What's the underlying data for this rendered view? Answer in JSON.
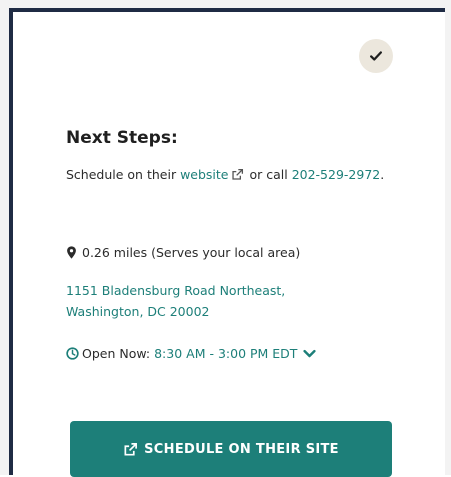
{
  "status": {
    "icon": "check-icon"
  },
  "next_steps": {
    "heading": "Next Steps:",
    "schedule_prefix": "Schedule on their ",
    "website_link": "website",
    "website_icon": "external-link-icon",
    "or_call": " or call ",
    "phone": "202-529-2972",
    "period": "."
  },
  "location": {
    "icon": "map-pin-icon",
    "distance": "0.26 miles (Serves your local area)",
    "address": "1151 Bladensburg Road Northeast, Washington, DC 20002"
  },
  "hours": {
    "icon": "clock-icon",
    "label": "Open Now:",
    "range": "8:30 AM - 3:00 PM EDT",
    "toggle_icon": "chevron-down-icon"
  },
  "cta": {
    "icon": "external-link-icon",
    "label": "SCHEDULE ON THEIR SITE"
  },
  "colors": {
    "accent": "#1d7f79",
    "border": "#1f2b44",
    "badge": "#ece7dd"
  }
}
